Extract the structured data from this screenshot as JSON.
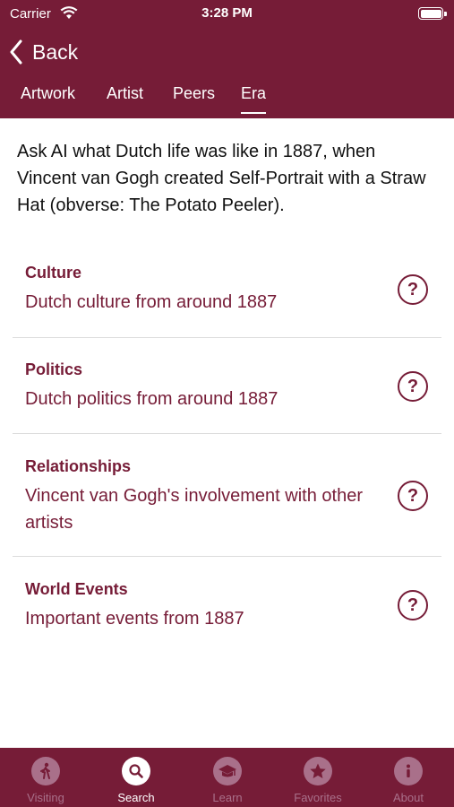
{
  "status_bar": {
    "carrier": "Carrier",
    "time": "3:28 PM"
  },
  "nav": {
    "back_label": "Back"
  },
  "tabs": [
    "Artwork",
    "Artist",
    "Peers",
    "Era"
  ],
  "active_tab": "Era",
  "intro": "Ask AI what Dutch life was like in 1887, when Vincent van Gogh created Self-Portrait with a Straw Hat (obverse: The Potato Peeler).",
  "topics": [
    {
      "title": "Culture",
      "description": "Dutch culture from around 1887",
      "icon": "help-icon"
    },
    {
      "title": "Politics",
      "description": "Dutch politics from around 1887",
      "icon": "help-icon"
    },
    {
      "title": "Relationships",
      "description": "Vincent van Gogh's involvement with other artists",
      "icon": "help-icon"
    },
    {
      "title": "World Events",
      "description": "Important events from 1887",
      "icon": "help-icon"
    }
  ],
  "help_glyph": "?",
  "tab_bar": [
    {
      "label": "Visiting",
      "icon": "walking-person-icon"
    },
    {
      "label": "Search",
      "icon": "magnifier-icon"
    },
    {
      "label": "Learn",
      "icon": "graduation-cap-icon"
    },
    {
      "label": "Favorites",
      "icon": "star-icon"
    },
    {
      "label": "About",
      "icon": "info-icon"
    }
  ],
  "active_tab_bar_item": "Search",
  "colors": {
    "brand": "#761c37",
    "inactive_tab_bar": "#a9708a",
    "divider": "#dcdcdc"
  }
}
